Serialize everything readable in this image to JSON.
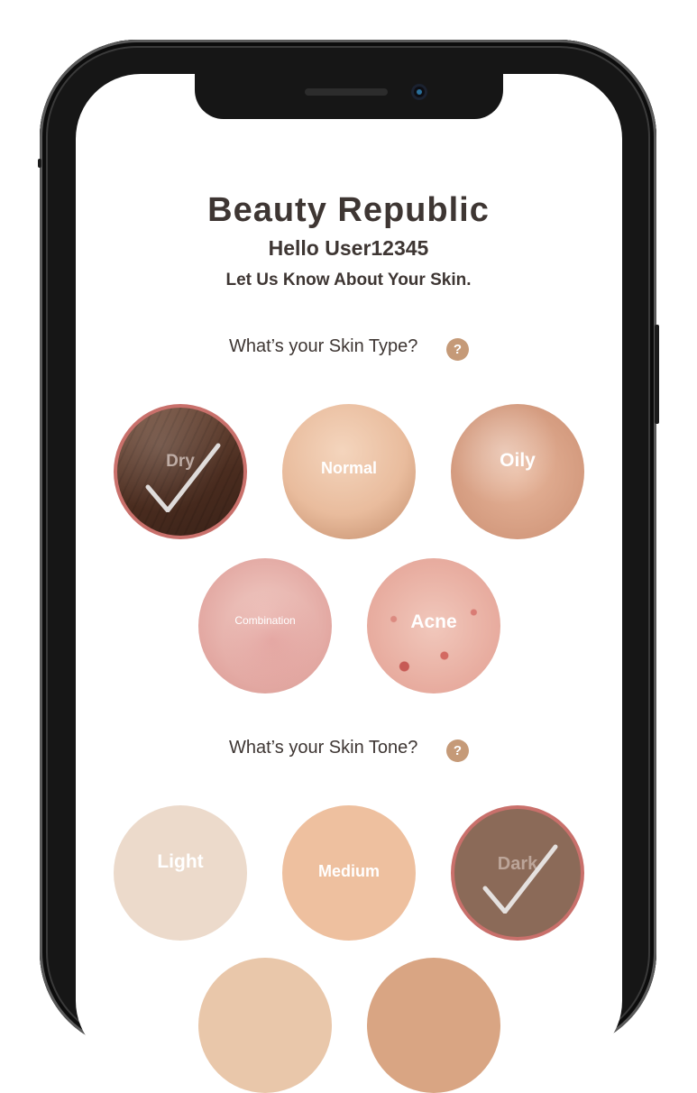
{
  "app": {
    "title": "Beauty Republic",
    "greeting": "Hello User12345",
    "prompt": "Let Us Know About Your Skin."
  },
  "skin_type": {
    "question": "What’s your Skin Type?",
    "help_label": "?",
    "options": [
      {
        "label": "Dry",
        "selected": true
      },
      {
        "label": "Normal",
        "selected": false
      },
      {
        "label": "Oily",
        "selected": false
      },
      {
        "label": "Combination",
        "selected": false
      },
      {
        "label": "Acne",
        "selected": false
      }
    ]
  },
  "skin_tone": {
    "question": "What’s your Skin Tone?",
    "help_label": "?",
    "options": [
      {
        "label": "Light",
        "selected": false,
        "color": "#ecdacb"
      },
      {
        "label": "Medium",
        "selected": false,
        "color": "#eec09f"
      },
      {
        "label": "Dark",
        "selected": true,
        "color": "#8b6a58"
      }
    ]
  },
  "colors": {
    "text": "#3e3633",
    "help_badge": "#c59a78",
    "selected_ring": "#c9706b"
  },
  "icons": {
    "check": "check-icon",
    "help": "help-icon"
  }
}
